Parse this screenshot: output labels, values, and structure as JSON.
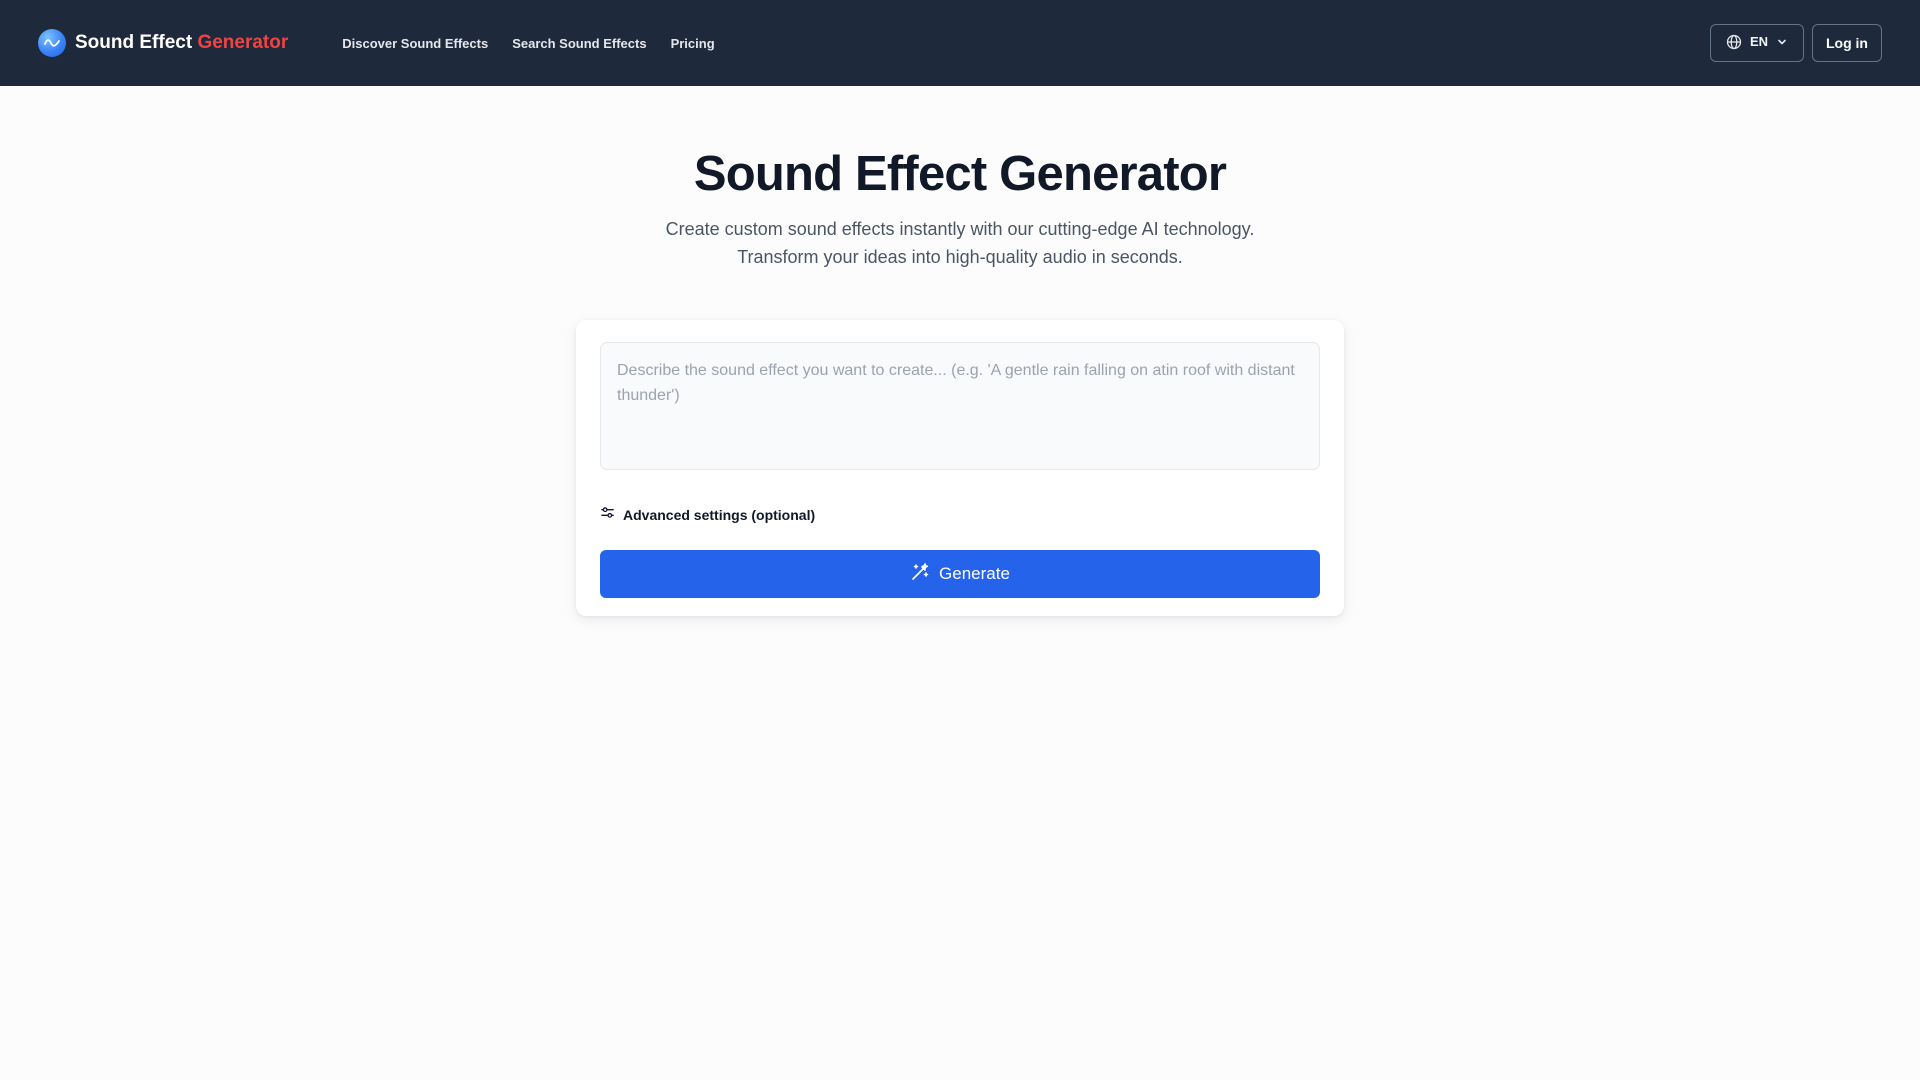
{
  "header": {
    "brand_main": "Sound Effect",
    "brand_accent": "Generator",
    "logo_icon": "waveform-icon",
    "nav": [
      {
        "label": "Discover Sound Effects"
      },
      {
        "label": "Search Sound Effects"
      },
      {
        "label": "Pricing"
      }
    ],
    "language": {
      "code": "EN",
      "icon": "globe-icon"
    },
    "login_label": "Log in"
  },
  "hero": {
    "title": "Sound Effect Generator",
    "subtitle_line1": "Create custom sound effects instantly with our cutting-edge AI technology.",
    "subtitle_line2": "Transform your ideas into high-quality audio in seconds."
  },
  "generator": {
    "prompt_value": "",
    "prompt_placeholder": "Describe the sound effect you want to create... (e.g. 'A gentle rain falling on atin roof with distant thunder')",
    "advanced_label": "Advanced settings (optional)",
    "advanced_icon": "sliders-icon",
    "generate_label": "Generate",
    "generate_icon": "magic-wand-icon"
  },
  "colors": {
    "header_bg": "#1e293b",
    "brand_accent": "#ef4444",
    "primary": "#2563eb",
    "page_bg": "#fcfcfd"
  }
}
